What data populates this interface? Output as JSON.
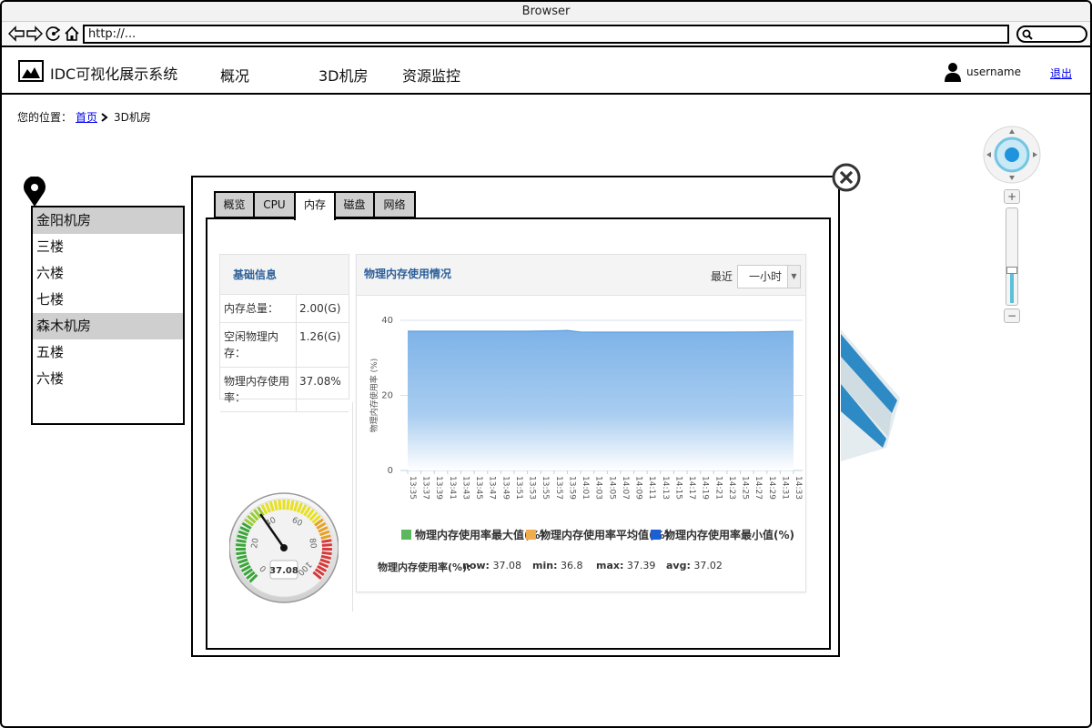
{
  "browser": {
    "title": "Browser",
    "url": "http://..."
  },
  "app": {
    "title": "IDC可视化展示系统",
    "nav": [
      "概况",
      "3D机房",
      "资源监控"
    ],
    "username": "username",
    "logout": "退出"
  },
  "breadcrumb": {
    "prefix": "您的位置：",
    "home": "首页",
    "current": "3D机房"
  },
  "rooms": [
    {
      "label": "金阳机房",
      "highlight": true
    },
    {
      "label": "三楼",
      "highlight": false
    },
    {
      "label": "六楼",
      "highlight": false
    },
    {
      "label": "七楼",
      "highlight": false
    },
    {
      "label": "森木机房",
      "highlight": true
    },
    {
      "label": "五楼",
      "highlight": false
    },
    {
      "label": "六楼",
      "highlight": false
    }
  ],
  "zoom": {
    "plus": "+",
    "minus": "−",
    "level": 0.35
  },
  "dialog": {
    "tabs": [
      "概览",
      "CPU",
      "内存",
      "磁盘",
      "网络"
    ],
    "active_tab": "内存",
    "info": {
      "title": "基础信息",
      "rows": [
        {
          "k": "内存总量：",
          "v": "2.00(G)"
        },
        {
          "k": "空闲物理内存：",
          "v": "1.26(G)"
        },
        {
          "k": "物理内存使用率：",
          "v": "37.08%"
        }
      ]
    },
    "gauge": {
      "value": 37.08,
      "display": "37.08",
      "min": 0,
      "max": 100,
      "ticks": [
        "0",
        "20",
        "40",
        "60",
        "80",
        "100"
      ]
    },
    "chart_header": {
      "title": "物理内存使用情况",
      "recent_label": "最近",
      "range_value": "一小时",
      "range_arrow": "▼"
    },
    "legend": [
      "物理内存使用率最大值(%)",
      "物理内存使用率平均值(%)",
      "物理内存使用率最小值(%)"
    ],
    "legend_colors": [
      "#5cb85c",
      "#f0ad4e",
      "#1a5fd6"
    ],
    "stats": {
      "label": "物理内存使用率(%):",
      "now_label": "now:",
      "now": "37.08",
      "min_label": "min:",
      "min": "36.8",
      "max_label": "max:",
      "max": "37.39",
      "avg_label": "avg:",
      "avg": "37.02"
    }
  },
  "chart_data": {
    "type": "area",
    "title": "物理内存使用情况",
    "xlabel": "",
    "ylabel": "物理内存使用率 (%)",
    "ylim": [
      0,
      40
    ],
    "yticks": [
      0,
      20,
      40
    ],
    "grid": true,
    "x": [
      "13:35",
      "13:37",
      "13:39",
      "13:41",
      "13:43",
      "13:45",
      "13:47",
      "13:49",
      "13:51",
      "13:53",
      "13:55",
      "13:57",
      "13:59",
      "14:01",
      "14:03",
      "14:05",
      "14:07",
      "14:09",
      "14:11",
      "14:13",
      "14:15",
      "14:17",
      "14:19",
      "14:21",
      "14:23",
      "14:25",
      "14:27",
      "14:29",
      "14:31",
      "14:33"
    ],
    "series": [
      {
        "values": [
          37.1,
          37.1,
          37.1,
          37.1,
          37.1,
          37.1,
          37.1,
          37.1,
          37.1,
          37.1,
          37.15,
          37.2,
          37.3,
          36.9,
          36.85,
          36.85,
          36.85,
          36.85,
          36.85,
          36.85,
          36.85,
          36.85,
          36.85,
          36.85,
          36.85,
          36.9,
          36.9,
          36.95,
          37.0,
          37.08
        ]
      }
    ],
    "color": "#7eb3e8"
  }
}
